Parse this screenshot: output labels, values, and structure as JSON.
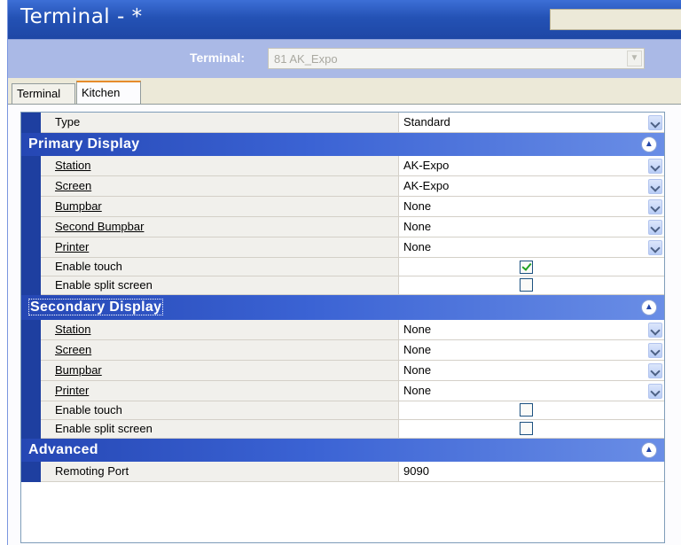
{
  "window": {
    "title": "Terminal - *"
  },
  "selector": {
    "label": "Terminal:",
    "value": "81 AK_Expo"
  },
  "tabs": [
    {
      "label": "Terminal",
      "active": false
    },
    {
      "label": "Kitchen",
      "active": true
    }
  ],
  "properties": {
    "type_row": {
      "name": "Type",
      "value": "Standard"
    },
    "primary": {
      "title": "Primary Display",
      "station": {
        "name": "Station",
        "value": "AK-Expo"
      },
      "screen": {
        "name": "Screen",
        "value": "AK-Expo"
      },
      "bumpbar": {
        "name": "Bumpbar",
        "value": "None"
      },
      "second_bumpbar": {
        "name": "Second Bumpbar",
        "value": "None"
      },
      "printer": {
        "name": "Printer",
        "value": "None"
      },
      "enable_touch": {
        "name": "Enable touch",
        "checked": true
      },
      "enable_split": {
        "name": "Enable split screen",
        "checked": false
      }
    },
    "secondary": {
      "title": "Secondary Display",
      "station": {
        "name": "Station",
        "value": "None"
      },
      "screen": {
        "name": "Screen",
        "value": "None"
      },
      "bumpbar": {
        "name": "Bumpbar",
        "value": "None"
      },
      "printer": {
        "name": "Printer",
        "value": "None"
      },
      "enable_touch": {
        "name": "Enable touch",
        "checked": false
      },
      "enable_split": {
        "name": "Enable split screen",
        "checked": false
      }
    },
    "advanced": {
      "title": "Advanced",
      "remoting_port": {
        "name": "Remoting Port",
        "value": "9090"
      }
    }
  },
  "colors": {
    "title_bar": "#2452b5",
    "category_header": "#2547b4",
    "selector_bar": "#aab9e6",
    "tab_highlight": "#e68b2c"
  }
}
